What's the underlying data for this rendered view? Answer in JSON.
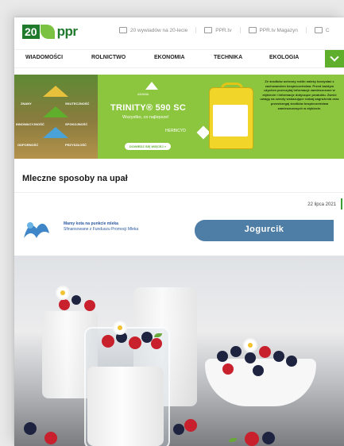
{
  "header": {
    "logo_text": "20",
    "logo_brand": "ppr",
    "links": [
      {
        "icon": "video-icon",
        "label": "20 wywiadów na 20-lecie"
      },
      {
        "icon": "tv-icon",
        "label": "PPR.tv"
      },
      {
        "icon": "tv-icon",
        "label": "PPR.tv Magazyn"
      },
      {
        "icon": "tv-icon",
        "label": "C"
      }
    ]
  },
  "nav": {
    "items": [
      "WIADOMOŚCI",
      "ROLNICTWO",
      "EKONOMIA",
      "TECHNIKA",
      "EKOLOGIA"
    ],
    "toggle_icon": "chevron-down-icon"
  },
  "ad": {
    "brand": "ADAMA",
    "title": "TRINITY® 590 SC",
    "tagline": "Wszystko, co najlepsze!",
    "category": "HERBICYD",
    "button": "DOWIEDZ SIĘ WIĘCEJ »",
    "field_labels": [
      "ZNANY",
      "SKUTECZNOŚĆ",
      "INNOWACYJNOŚĆ",
      "SPOKOJNOŚĆ",
      "ODPORNOŚĆ",
      "PRZYSZŁOŚĆ"
    ],
    "disclaimer": "Ze środków ochrony roślin należy korzystać z zachowaniem bezpieczeństwa. Przed każdym użyciem przeczytaj informacje zamieszczone w etykiecie i informacje dotyczące produktu. Zwróć uwagę na zwroty wskazujące rodzaj zagrożenia oraz przestrzegaj środków bezpieczeństwa zamieszczonych w etykiecie."
  },
  "article": {
    "title": "Mleczne sposoby na upał",
    "date": "22 lipca 2021"
  },
  "milk_banner": {
    "line1": "Mamy kota na punkcie mleka",
    "line2": "Sfinansowane z Funduszu Promocji Mleka",
    "product": "Jogurcik"
  },
  "colors": {
    "brand_green": "#1f7a2c",
    "accent_green": "#5fae2c",
    "ad_green": "#8cc63f",
    "milk_blue": "#4e7ea6"
  }
}
